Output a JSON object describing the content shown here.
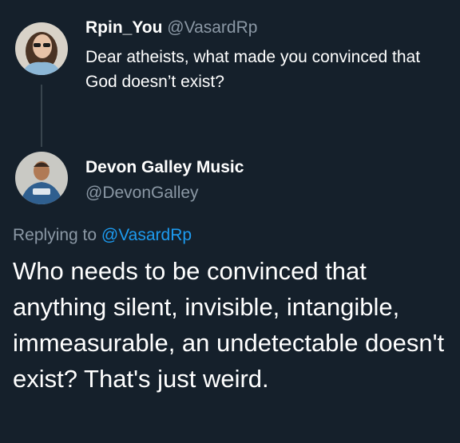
{
  "colors": {
    "background": "#15202b",
    "text": "#ffffff",
    "secondary_text": "#8b98a5",
    "link": "#1d9bf0",
    "thread_line": "#38444d"
  },
  "parent_tweet": {
    "avatar_icon": "user-avatar-icon",
    "display_name": "Rpin_You",
    "handle": "@VasardRp",
    "text": "Dear atheists, what made you convinced that God doesn’t exist?"
  },
  "reply_tweet": {
    "avatar_icon": "user-avatar-icon",
    "display_name": "Devon Galley Music",
    "handle": "@DevonGalley",
    "replying_prefix": "Replying to",
    "replying_to": "@VasardRp",
    "text": "Who needs to be convinced that anything silent, invisible, intangible, immeasurable, an undetectable doesn't exist? That's just weird."
  }
}
